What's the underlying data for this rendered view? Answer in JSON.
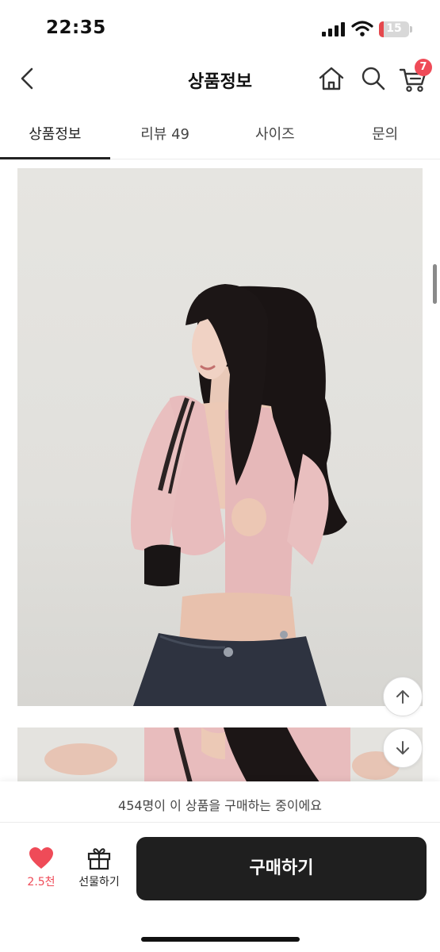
{
  "status_bar": {
    "time": "22:35",
    "battery": "15",
    "battery_level": 0.15
  },
  "header": {
    "title": "상품정보",
    "cart_badge": "7"
  },
  "tabs": [
    {
      "label": "상품정보",
      "active": true
    },
    {
      "label": "리뷰 49",
      "active": false
    },
    {
      "label": "사이즈",
      "active": false
    },
    {
      "label": "문의",
      "active": false
    }
  ],
  "bottom": {
    "notice": "454명이 이 상품을 구매하는 중이에요",
    "like_count": "2.5천",
    "gift_label": "선물하기",
    "buy_label": "구매하기"
  },
  "colors": {
    "accent": "#ef4b58",
    "buy_button": "#1f1f1f",
    "cardigan": "#e8bcbd",
    "jeans": "#2e3340",
    "hair": "#1a1414"
  },
  "icons": [
    "back-icon",
    "home-icon",
    "search-icon",
    "cart-icon",
    "heart-icon",
    "gift-icon",
    "arrow-up-icon",
    "arrow-down-icon"
  ]
}
